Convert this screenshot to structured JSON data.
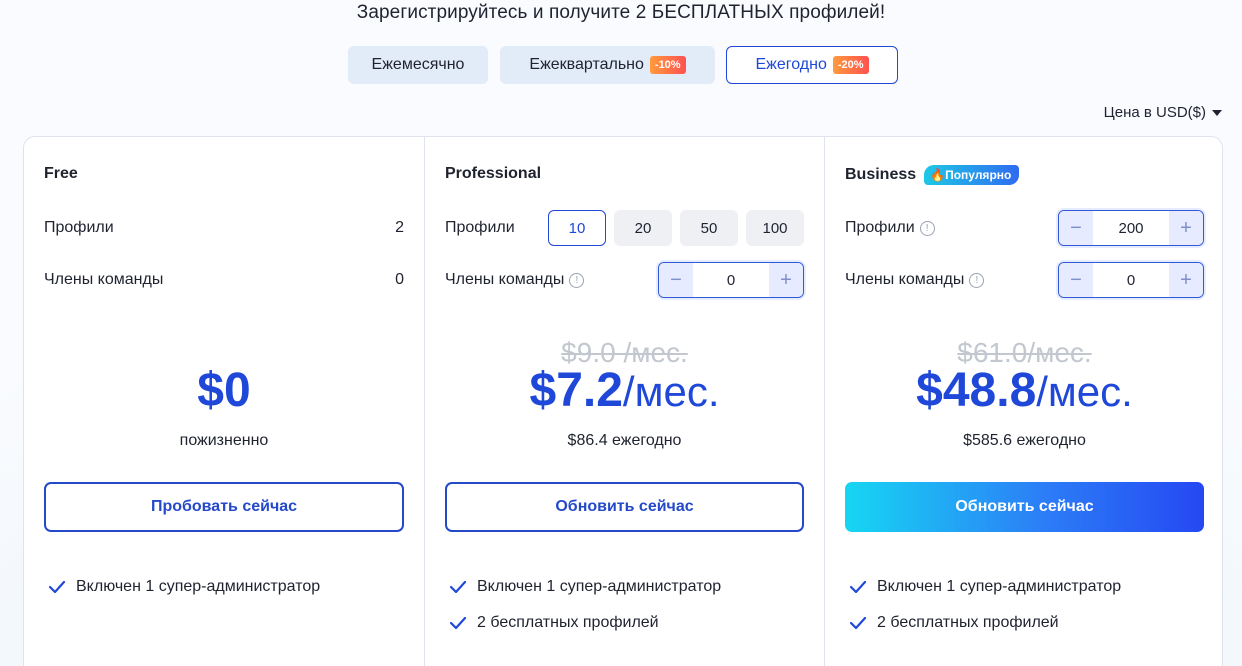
{
  "headline": "Зарегистрируйтесь и получите 2 БЕСПЛАТНЫХ профилей!",
  "billing": {
    "monthly": "Ежемесячно",
    "quarterly": "Ежеквартально",
    "quarterly_discount": "-10%",
    "yearly": "Ежегодно",
    "yearly_discount": "-20%",
    "active": "yearly"
  },
  "currency": "Цена в USD($)",
  "plans": {
    "free": {
      "name": "Free",
      "profiles_label": "Профили",
      "profiles_value": "2",
      "members_label": "Члены команды",
      "members_value": "0",
      "price": "$0",
      "period": "пожизненно",
      "cta": "Пробовать сейчас",
      "features": [
        "Включен 1 супер-администратор"
      ]
    },
    "professional": {
      "name": "Professional",
      "profiles_label": "Профили",
      "profile_options": [
        "10",
        "20",
        "50",
        "100"
      ],
      "selected_profile": "10",
      "members_label": "Члены команды",
      "members_value": "0",
      "old_price": "$9.0 /мес.",
      "price": "$7.2",
      "per": "/мес.",
      "annual": "$86.4 ежегодно",
      "cta": "Обновить сейчас",
      "features": [
        "Включен 1 супер-администратор",
        "2 бесплатных профилей"
      ]
    },
    "business": {
      "name": "Business",
      "badge": "Популярно",
      "profiles_label": "Профили",
      "profiles_value": "200",
      "members_label": "Члены команды",
      "members_value": "0",
      "old_price": "$61.0/мес.",
      "price": "$48.8",
      "per": "/мес.",
      "annual": "$585.6 ежегодно",
      "cta": "Обновить сейчас",
      "features": [
        "Включен 1 супер-администратор",
        "2 бесплатных профилей"
      ]
    }
  },
  "colors": {
    "accent": "#1f48d8",
    "cta_gradient_start": "#16d6f2",
    "cta_gradient_end": "#2548f3",
    "discount_start": "#ff9a3c",
    "discount_end": "#ff5151"
  }
}
